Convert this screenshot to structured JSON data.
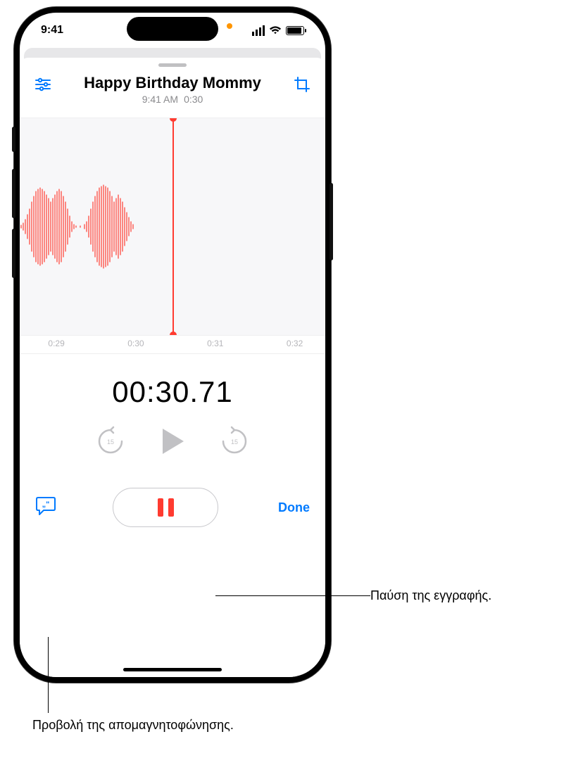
{
  "status": {
    "time": "9:41"
  },
  "recording": {
    "title": "Happy Birthday Mommy",
    "timestamp": "9:41 AM",
    "duration": "0:30"
  },
  "timeline": {
    "marks": [
      "0:29",
      "0:30",
      "0:31",
      "0:32"
    ]
  },
  "elapsed": "00:30.71",
  "transport": {
    "skip_seconds": "15"
  },
  "done_label": "Done",
  "callouts": {
    "pause": "Παύση της εγγραφής.",
    "transcript": "Προβολή της απομαγνητοφώνησης."
  }
}
